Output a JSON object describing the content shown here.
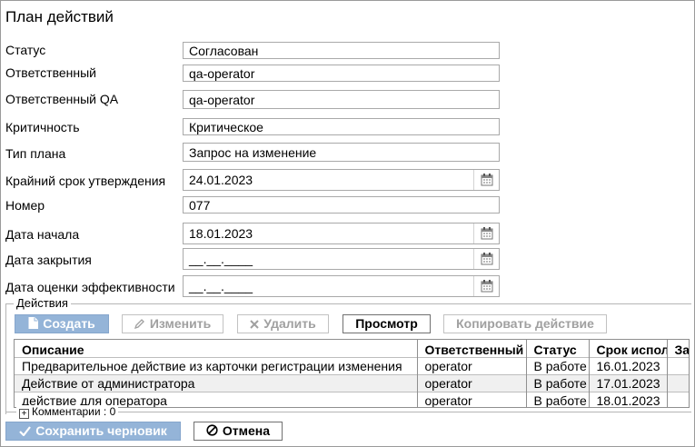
{
  "title": "План действий",
  "fields": [
    {
      "label": "Статус",
      "value": "Согласован"
    },
    {
      "label": "Ответственный",
      "value": "qa-operator"
    },
    {
      "label": "Ответственный QA",
      "value": "qa-operator"
    },
    {
      "label": "Критичность",
      "value": "Критическое"
    },
    {
      "label": "Тип плана",
      "value": "Запрос на изменение"
    },
    {
      "label": "Крайний срок утверждения",
      "value": "24.01.2023"
    },
    {
      "label": "Номер",
      "value": "077"
    },
    {
      "label": "Дата начала",
      "value": "18.01.2023"
    },
    {
      "label": "Дата закрытия",
      "value": "__.__.____"
    },
    {
      "label": "Дата оценки эффективности",
      "value": "__.__.____"
    }
  ],
  "actions": {
    "legend": "Действия",
    "toolbar": {
      "create": "Создать",
      "edit": "Изменить",
      "delete": "Удалить",
      "view": "Просмотр",
      "copy": "Копировать действие"
    },
    "columns": [
      "Описание",
      "Ответственный",
      "Статус",
      "Срок испол",
      "За"
    ],
    "rows": [
      [
        "Предварительное действие из карточки регистрации изменения",
        "operator",
        "В работе",
        "16.01.2023",
        ""
      ],
      [
        "Действие от администратора",
        "operator",
        "В работе",
        "17.01.2023",
        ""
      ],
      [
        "действие для оператора",
        "operator",
        "В работе",
        "18.01.2023",
        ""
      ]
    ]
  },
  "comments": {
    "label": "Комментарии : 0"
  },
  "footer": {
    "save_draft": "Сохранить черновик",
    "cancel": "Отмена"
  },
  "colors": {
    "primary": "#94b4d8",
    "border": "#a9a9a9"
  }
}
